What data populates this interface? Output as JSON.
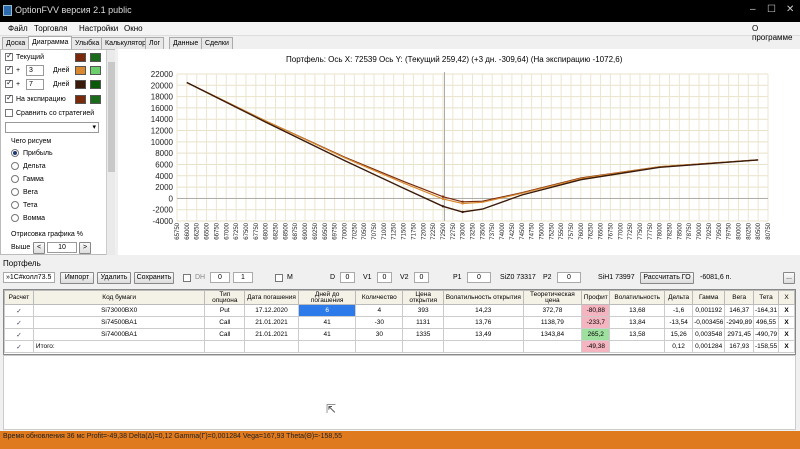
{
  "window": {
    "title": "OptionFVV версия 2.1 public",
    "controls": [
      "–",
      "☐",
      "✕"
    ]
  },
  "menu": {
    "items": [
      "Файл",
      "Торговля",
      "Настройки",
      "Окно"
    ],
    "about": "О программе"
  },
  "tabs": [
    "Доска",
    "Диаграмма",
    "Улыбка",
    "Калькулятор",
    "Лог",
    "Данные",
    "Сделки"
  ],
  "left": {
    "current": "Текущий",
    "plus1": "+",
    "days1_val": "3",
    "days1": "Дней",
    "plus2": "+",
    "days2_val": "7",
    "days2": "Дней",
    "expiration": "На экспирацию",
    "compare": "Сравнить со стратегией",
    "draw_title": "Чего рисуем",
    "options": [
      "Прибыль",
      "Дельта",
      "Гамма",
      "Вега",
      "Тета",
      "Вомма"
    ],
    "render": "Отрисовка графика %",
    "above": "Выше",
    "above_val": "10",
    "colors": [
      "#7a2a0a",
      "#1a6b1a",
      "#d98a30",
      "#6bd06b",
      "#3a1a0a",
      "#0a5a0a"
    ]
  },
  "chart": {
    "header": "Портфель: Ось X: 72539 Ось Y:  (Текущий 259,42)  (+3 дн. -309,64)  (На экспирацию -1072,6)",
    "y_ticks": [
      "22000",
      "20000",
      "18000",
      "16000",
      "14000",
      "12000",
      "10000",
      "8000",
      "6000",
      "4000",
      "2000",
      "0",
      "-2000",
      "-4000"
    ],
    "x_ticks": [
      "65750",
      "66000",
      "66250",
      "66500",
      "66750",
      "67000",
      "67250",
      "67500",
      "67750",
      "68000",
      "68250",
      "68500",
      "68750",
      "69000",
      "69250",
      "69500",
      "69750",
      "70000",
      "70250",
      "70500",
      "70750",
      "71000",
      "71250",
      "71500",
      "71750",
      "72000",
      "72250",
      "72500",
      "72750",
      "73000",
      "73250",
      "73500",
      "73750",
      "74000",
      "74250",
      "74500",
      "74750",
      "75000",
      "75250",
      "75500",
      "75750",
      "76000",
      "76250",
      "76500",
      "76750",
      "77000",
      "77250",
      "77500",
      "77750",
      "78000",
      "78250",
      "78500",
      "78750",
      "79000",
      "79250",
      "79500",
      "79750",
      "80000",
      "80250",
      "80500",
      "80750"
    ]
  },
  "chart_data": {
    "type": "line",
    "x_axis_value": 72539,
    "ylim": [
      -4000,
      22000
    ],
    "xlim": [
      65750,
      80750
    ],
    "series": [
      {
        "name": "Текущий",
        "color": "#7a2a0a",
        "x": [
          66000,
          68000,
          70000,
          71500,
          72500,
          73000,
          73500,
          74500,
          76000,
          78000,
          80500
        ],
        "y": [
          20500,
          13700,
          7300,
          3000,
          300,
          -600,
          -500,
          1000,
          3600,
          5600,
          6800
        ]
      },
      {
        "name": "+3 Дней",
        "color": "#d98a30",
        "x": [
          66000,
          68000,
          70000,
          71500,
          72500,
          73000,
          73500,
          74500,
          76000,
          78000,
          80500
        ],
        "y": [
          20500,
          13700,
          7200,
          2700,
          -100,
          -900,
          -700,
          900,
          3500,
          5600,
          6800
        ]
      },
      {
        "name": "На экспирацию",
        "color": "#3a1a0a",
        "x": [
          66000,
          68000,
          70000,
          71500,
          72500,
          73000,
          73500,
          74500,
          76000,
          78000,
          80500
        ],
        "y": [
          20500,
          13500,
          6700,
          1800,
          -1400,
          -2400,
          -1900,
          600,
          3300,
          5500,
          6800
        ]
      }
    ]
  },
  "portfolio": {
    "label": "Портфель",
    "select": "»1С#колл73.5",
    "import": "Импорт",
    "delete": "Удалить",
    "save": "Сохранить",
    "dh": "DH",
    "dh_val": "0",
    "dh_val2": "1",
    "m": "M",
    "d": "D",
    "d_val": "0",
    "v1": "V1",
    "v1_val": "0",
    "v2": "V2",
    "v2_val": "0",
    "p1": "P1",
    "p1_val": "0",
    "siz0": "SiZ0 73317",
    "p2": "P2",
    "p2_val": "0",
    "sih1": "SiH1 73997",
    "calc_go": "Рассчитать ГО",
    "go_val": "-6081,6 п.",
    "more": "..."
  },
  "table": {
    "headers": [
      "Расчет",
      "Код бумаги",
      "Тип опциона",
      "Дата погашения",
      "Дней до погашения",
      "Количество",
      "Цена открытия",
      "Волатильность открытия",
      "Теоретическая цена",
      "Профит",
      "Волатильность",
      "Дельта",
      "Гамма",
      "Вега",
      "Тета",
      "X"
    ],
    "rows": [
      [
        "✓",
        "Si73000BX0",
        "Put",
        "17.12.2020",
        "6",
        "4",
        "393",
        "14,23",
        "372,78",
        "-80,88",
        "13,68",
        "-1,6",
        "0,001192",
        "146,37",
        "-164,31",
        "X"
      ],
      [
        "✓",
        "Si74500BA1",
        "Call",
        "21.01.2021",
        "41",
        "-30",
        "1131",
        "13,76",
        "1138,79",
        "-233,7",
        "13,84",
        "-13,54",
        "-0,003456",
        "-2949,89",
        "496,55",
        "X"
      ],
      [
        "✓",
        "Si74000BA1",
        "Call",
        "21.01.2021",
        "41",
        "30",
        "1335",
        "13,49",
        "1343,84",
        "265,2",
        "13,58",
        "15,26",
        "0,003548",
        "2971,45",
        "-490,79",
        "X"
      ],
      [
        "✓",
        "Итого:",
        "",
        "",
        "",
        "",
        "",
        "",
        "",
        "-49,38",
        "",
        "0,12",
        "0,001284",
        "167,93",
        "-158,55",
        "X"
      ]
    ]
  },
  "status": "Время обновления 36 мс  Profit=-49,38 Delta(Δ)=0,12 Gamma(Γ)=0,001284 Vega=167,93 Theta(Θ)=-158,55"
}
